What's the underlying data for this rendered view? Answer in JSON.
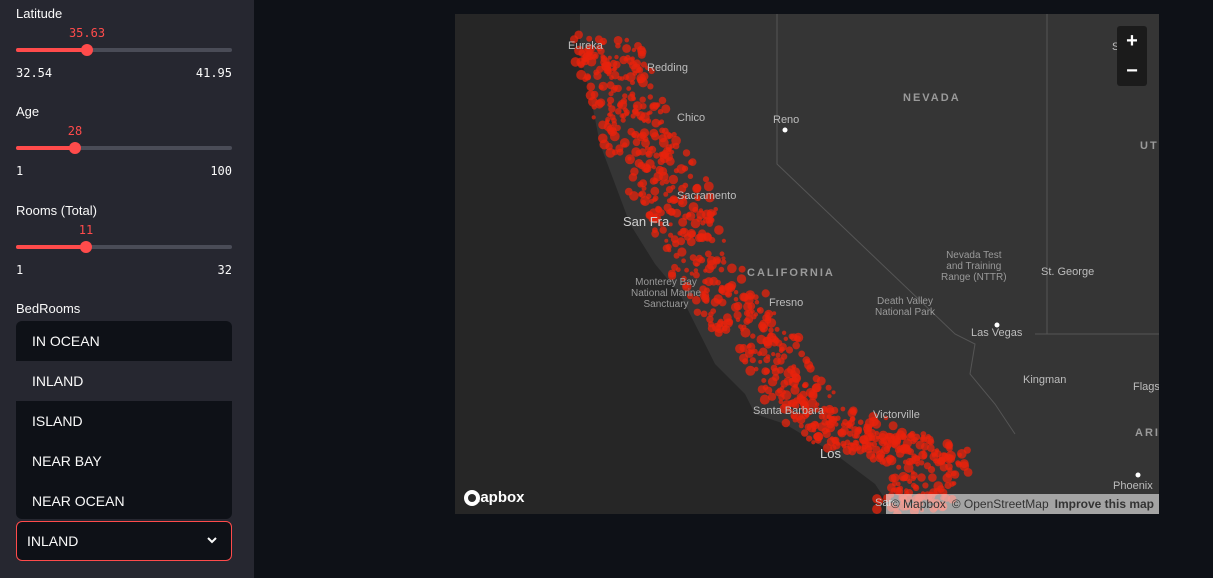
{
  "sliders": [
    {
      "key": "latitude",
      "label": "Latitude",
      "value": "35.63",
      "min": "32.54",
      "max": "41.95",
      "fraction": 0.33
    },
    {
      "key": "age",
      "label": "Age",
      "value": "28",
      "min": "1",
      "max": "100",
      "fraction": 0.27
    },
    {
      "key": "rooms",
      "label": "Rooms (Total)",
      "value": "11",
      "min": "1",
      "max": "32",
      "fraction": 0.32
    }
  ],
  "bedrooms_label": "BedRooms",
  "dropdown": {
    "options": [
      "IN OCEAN",
      "INLAND",
      "ISLAND",
      "NEAR BAY",
      "NEAR OCEAN"
    ],
    "highlighted_index": 1,
    "selected": "INLAND"
  },
  "map": {
    "labels": {
      "eureka": "Eureka",
      "redding": "Redding",
      "chico": "Chico",
      "nevada": "NEVADA",
      "reno": "Reno",
      "utah": "UT",
      "sacramento": "Sacramento",
      "san_francisco": "San Fra",
      "california": "CALIFORNIA",
      "fresno": "Fresno",
      "monterey": "Monterey Bay\nNational Marine\nSanctuary",
      "nevada_test": "Nevada Test\nand Training\nRange (NTTR)",
      "st_george": "St. George",
      "death_valley": "Death Valley\nNational Park",
      "las_vegas": "Las Vegas",
      "kingman": "Kingman",
      "flagstaff": "Flags",
      "santa_barbara": "Santa Barbara",
      "victorville": "Victorville",
      "los_angeles": "Los",
      "arizona": "ARI",
      "phoenix": "Phoenix",
      "san_diego": "San",
      "salt_lake": "S    ke"
    },
    "zoom_in": "+",
    "zoom_out": "−",
    "logo_text": "mapbox",
    "attribution": [
      "© Mapbox",
      "© OpenStreetMap",
      "Improve this map"
    ],
    "point_color": "#e8230c",
    "land_color": "#343434",
    "ocean_color": "#262626"
  }
}
